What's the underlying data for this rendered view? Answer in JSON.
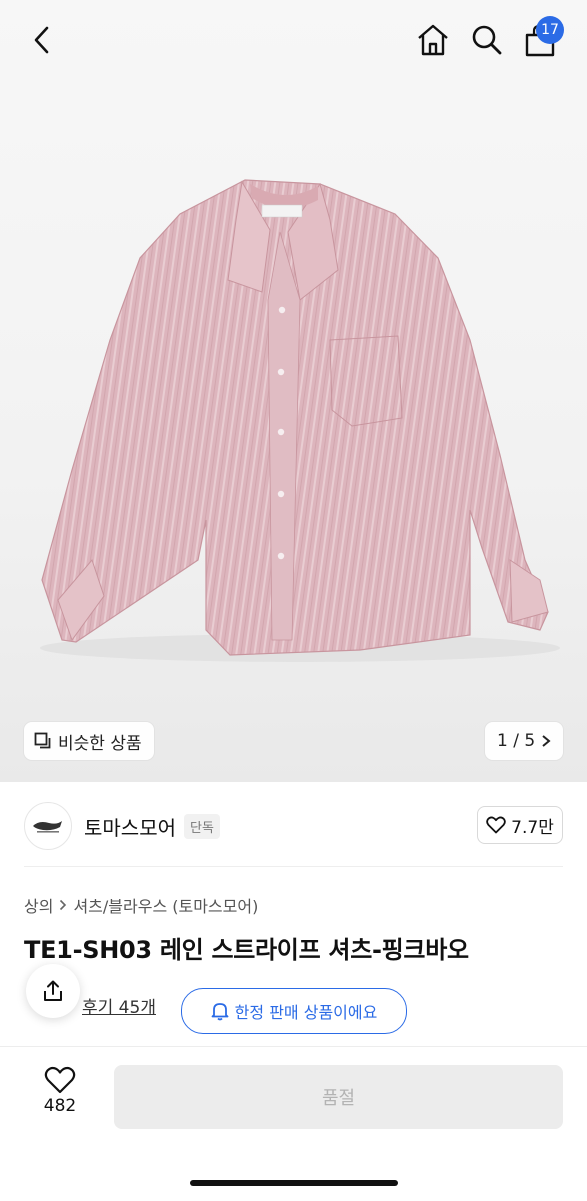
{
  "header": {
    "back_icon": "chevron-left-icon",
    "home_icon": "home-icon",
    "search_icon": "search-icon",
    "cart_icon": "shopping-bag-icon",
    "cart_count": "17",
    "badge_color": "#2b6be6"
  },
  "hero": {
    "similar_label": "비슷한 상품",
    "page_indicator": "1 / 5"
  },
  "brand": {
    "name": "토마스모어",
    "tag": "단독",
    "likes": "7.7만"
  },
  "breadcrumb": {
    "level1": "상의",
    "level2": "셔츠/블라우스 (토마스모어)"
  },
  "product": {
    "title": "TE1-SH03 레인 스트라이프 셔츠-핑크바오",
    "review_link": "후기 45개",
    "notice": "한정 판매 상품이에요"
  },
  "bottom": {
    "wish_count": "482",
    "buy_label": "품절"
  }
}
